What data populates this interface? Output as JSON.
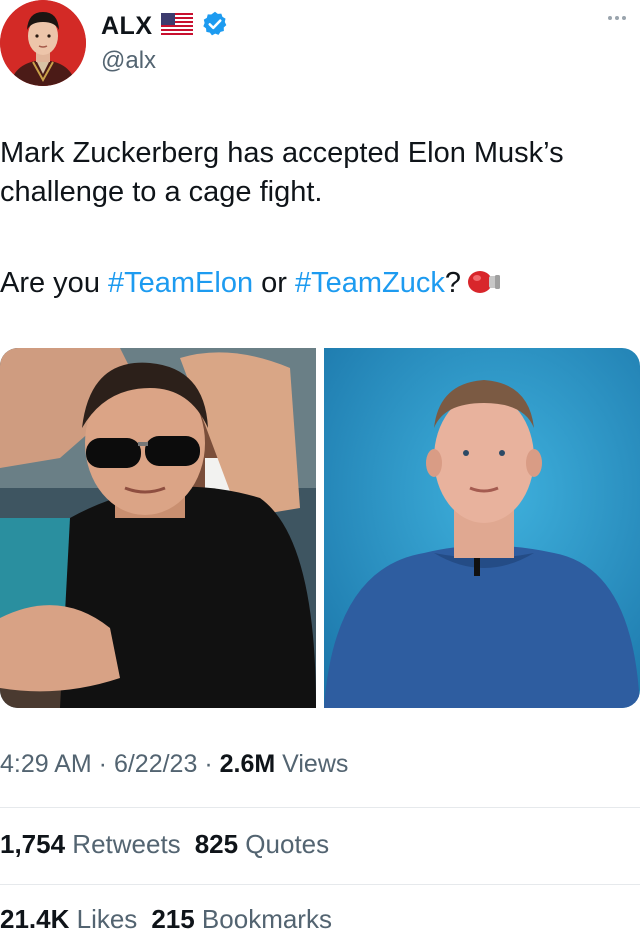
{
  "author": {
    "name": "ALX",
    "handle": "@alx",
    "flag_icon": "us-flag-icon",
    "verified_icon": "verified-badge-icon",
    "verified_color": "#1d9bf0"
  },
  "tweet": {
    "line1": "Mark Zuckerberg has accepted Elon Musk’s",
    "line2": "challenge to a cage fight.",
    "line3_prefix": "Are you ",
    "hashtag1": "#TeamElon",
    "line3_mid": " or ",
    "hashtag2": "#TeamZuck",
    "line3_suffix": "?",
    "emoji_icon": "boxing-glove-icon",
    "hashtag_color": "#1d9bf0"
  },
  "media": [
    {
      "icon": "photo-elon-musk"
    },
    {
      "icon": "photo-mark-zuckerberg"
    }
  ],
  "meta": {
    "time": "4:29 AM",
    "separator": " · ",
    "date": "6/22/23",
    "views_count": "2.6M",
    "views_label": " Views"
  },
  "stats": {
    "retweets_count": "1,754",
    "retweets_label": " Retweets",
    "quotes_count": "825",
    "quotes_label": " Quotes",
    "likes_count": "21.4K",
    "likes_label": " Likes",
    "bookmarks_count": "215",
    "bookmarks_label": " Bookmarks"
  }
}
